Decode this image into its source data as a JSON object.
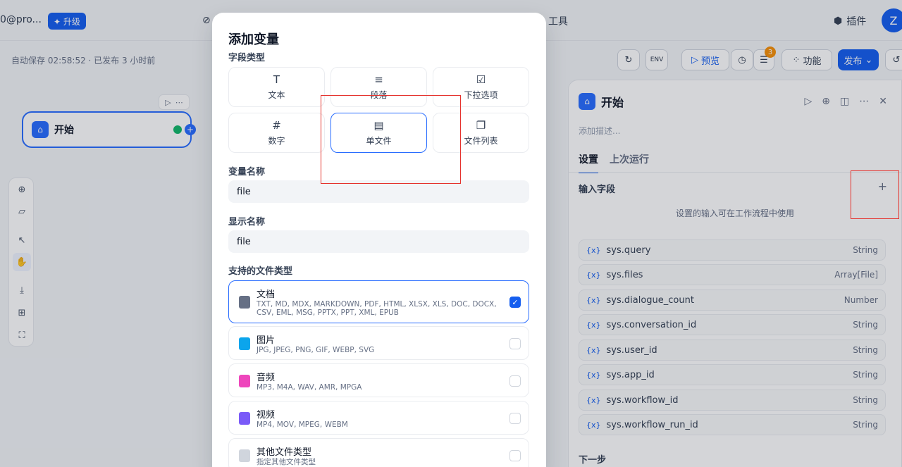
{
  "topbar": {
    "account": "0@pro...",
    "upgrade_label": "✦ 升级",
    "tools_label": "工具",
    "plugins_label": "插件",
    "avatar_letter": "Z"
  },
  "workflow": {
    "autosave": "自动保存 02:58:52 · 已发布 3 小时前",
    "preview_label": "预览",
    "features_label": "功能",
    "publish_label": "发布",
    "env_label": "ENV",
    "badge_count": "3"
  },
  "canvas": {
    "start_node_title": "开始"
  },
  "right_panel": {
    "title": "开始",
    "description_placeholder": "添加描述...",
    "tabs": [
      "设置",
      "上次运行"
    ],
    "input_section": "输入字段",
    "add_label": "+",
    "hint": "设置的输入可在工作流程中使用",
    "variables": [
      {
        "name": "sys.query",
        "type": "String"
      },
      {
        "name": "sys.files",
        "type": "Array[File]"
      },
      {
        "name": "sys.dialogue_count",
        "type": "Number"
      },
      {
        "name": "sys.conversation_id",
        "type": "String"
      },
      {
        "name": "sys.user_id",
        "type": "String"
      },
      {
        "name": "sys.app_id",
        "type": "String"
      },
      {
        "name": "sys.workflow_id",
        "type": "String"
      },
      {
        "name": "sys.workflow_run_id",
        "type": "String"
      }
    ],
    "var_prefix": "{x}",
    "next_step": "下一步"
  },
  "modal": {
    "title": "添加变量",
    "field_type_label": "字段类型",
    "field_types": [
      {
        "label": "文本",
        "icon": "T"
      },
      {
        "label": "段落",
        "icon": "≡"
      },
      {
        "label": "下拉选项",
        "icon": "☑"
      },
      {
        "label": "数字",
        "icon": "#"
      },
      {
        "label": "单文件",
        "icon": "▤"
      },
      {
        "label": "文件列表",
        "icon": "❐"
      }
    ],
    "var_name_label": "变量名称",
    "var_name_value": "file",
    "display_name_label": "显示名称",
    "display_name_value": "file",
    "file_types_label": "支持的文件类型",
    "file_types": [
      {
        "name": "文档",
        "desc": "TXT, MD, MDX, MARKDOWN, PDF, HTML, XLSX, XLS, DOC, DOCX, CSV, EML, MSG, PPTX, PPT, XML, EPUB",
        "checked": true,
        "color": "#667085"
      },
      {
        "name": "图片",
        "desc": "JPG, JPEG, PNG, GIF, WEBP, SVG",
        "checked": false,
        "color": "#0ba5ec"
      },
      {
        "name": "音频",
        "desc": "MP3, M4A, WAV, AMR, MPGA",
        "checked": false,
        "color": "#ee46bc"
      },
      {
        "name": "视频",
        "desc": "MP4, MOV, MPEG, WEBM",
        "checked": false,
        "color": "#7a5af8"
      },
      {
        "name": "其他文件类型",
        "desc": "指定其他文件类型",
        "checked": false,
        "color": "#d0d5dd"
      }
    ]
  },
  "colors": {
    "accent": "#155eef",
    "highlight": "#e5322d"
  }
}
